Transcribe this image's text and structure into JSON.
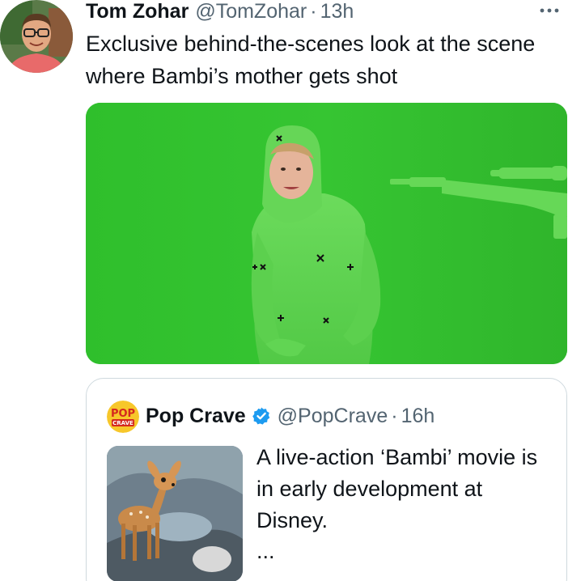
{
  "tweet": {
    "author_name": "Tom Zohar",
    "author_handle": "@TomZohar",
    "separator": "·",
    "time": "13h",
    "more_label": "···",
    "text": "Exclusive behind-the-scenes look at the scene where Bambi’s mother gets shot",
    "avatar_icon": "person-avatar-icon",
    "media_icon": "green-screen-photo"
  },
  "quote": {
    "author_name": "Pop Crave",
    "author_handle": "@PopCrave",
    "separator": "·",
    "time": "16h",
    "text": "A live-action ‘Bambi’ movie is in early development at Disney.",
    "ellipsis": "...",
    "logo_text_top": "POP",
    "logo_text_bottom": "CRAVE",
    "verified_icon": "verified-badge-icon",
    "thumbnail_icon": "bambi-cartoon-thumbnail"
  },
  "colors": {
    "chroma_green": "#2ec12a",
    "verified_blue": "#1d9bf0",
    "secondary_text": "#536471",
    "border": "#cfd9de"
  }
}
